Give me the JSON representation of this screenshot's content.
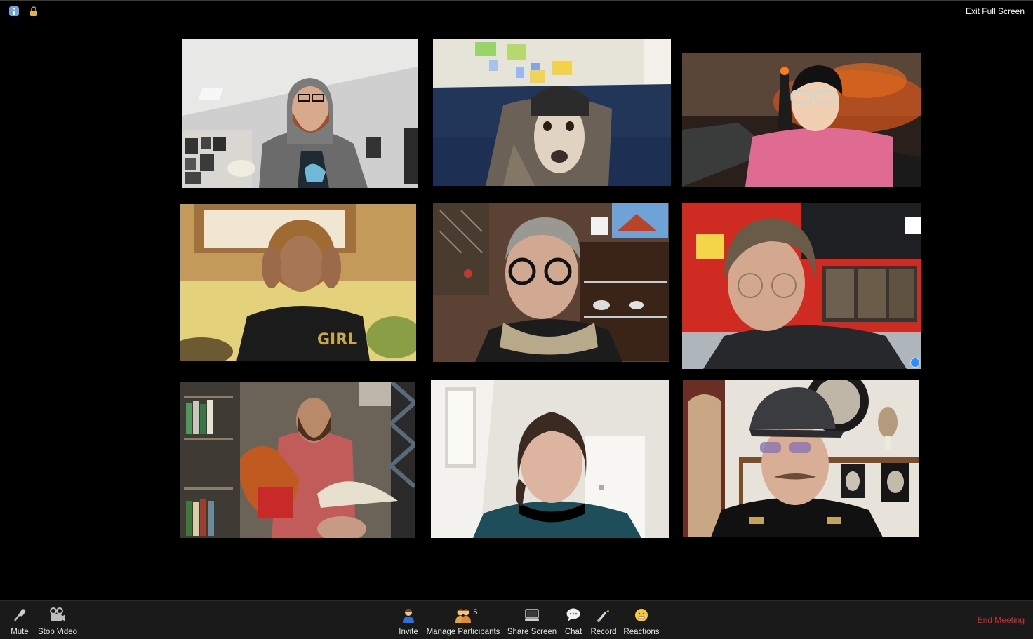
{
  "window": {
    "exit_fullscreen_label": "Exit Full Screen",
    "top_icons": [
      "info-icon",
      "lock-icon"
    ]
  },
  "gallery": {
    "tiles": [
      {
        "icon": "video-feed"
      },
      {
        "icon": "video-feed"
      },
      {
        "icon": "video-feed"
      },
      {
        "icon": "video-feed"
      },
      {
        "icon": "video-feed"
      },
      {
        "icon": "video-feed",
        "active_speaker": true
      },
      {
        "icon": "video-feed"
      },
      {
        "icon": "video-feed"
      },
      {
        "icon": "video-feed"
      }
    ]
  },
  "toolbar": {
    "mute_label": "Mute",
    "stop_video_label": "Stop Video",
    "invite_label": "Invite",
    "manage_participants_label": "Manage Participants",
    "participant_count": "5",
    "share_screen_label": "Share Screen",
    "chat_label": "Chat",
    "record_label": "Record",
    "reactions_label": "Reactions",
    "end_meeting_label": "End Meeting"
  },
  "colors": {
    "background": "#000000",
    "toolbar_bg": "#1a1a1a",
    "end_meeting": "#e02828",
    "active_dot": "#2d8cff"
  }
}
